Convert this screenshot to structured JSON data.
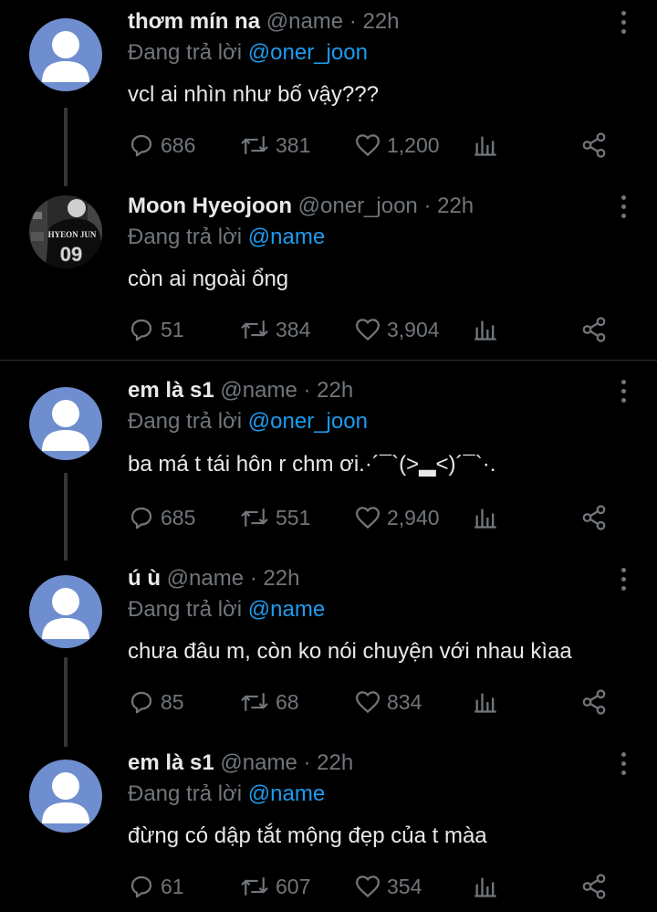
{
  "tweets": [
    {
      "name": "thơm mín na",
      "handle": "@name",
      "time": "· 22h",
      "reply_prefix": "Đang trả lời",
      "reply_to": "@oner_joon",
      "text": "vcl ai nhìn như bố vậy???",
      "replies": "686",
      "retweets": "381",
      "likes": "1,200"
    },
    {
      "name": "Moon Hyeojoon",
      "handle": "@oner_joon",
      "time": "· 22h",
      "reply_prefix": "Đang trả lời",
      "reply_to": "@name",
      "text": "còn ai ngoài ổng",
      "replies": "51",
      "retweets": "384",
      "likes": "3,904",
      "avatar_jersey": "HYEON JUN",
      "avatar_number": "09"
    },
    {
      "name": "em là s1",
      "handle": "@name",
      "time": "· 22h",
      "reply_prefix": "Đang trả lời",
      "reply_to": "@oner_joon",
      "text": "ba má t tái hôn r chm ơi.·´¯`(>▂<)´¯`·.",
      "replies": "685",
      "retweets": "551",
      "likes": "2,940"
    },
    {
      "name": "ú ù",
      "handle": "@name",
      "time": "· 22h",
      "reply_prefix": "Đang trả lời",
      "reply_to": "@name",
      "text": "chưa đâu m, còn ko nói chuyện với nhau kìaa",
      "replies": "85",
      "retweets": "68",
      "likes": "834"
    },
    {
      "name": "em là s1",
      "handle": "@name",
      "time": "· 22h",
      "reply_prefix": "Đang trả lời",
      "reply_to": "@name",
      "text": "đừng có dập tắt mộng đẹp của t màa",
      "replies": "61",
      "retweets": "607",
      "likes": "354"
    }
  ],
  "colors": {
    "background": "#000000",
    "text": "#e7e9ea",
    "muted": "#71767b",
    "mention": "#1d9bf0",
    "avatar_default": "#6f8ecf"
  },
  "icons": {
    "reply": "reply-icon",
    "retweet": "retweet-icon",
    "like": "heart-icon",
    "views": "views-icon",
    "share": "share-icon",
    "more": "more-icon"
  }
}
